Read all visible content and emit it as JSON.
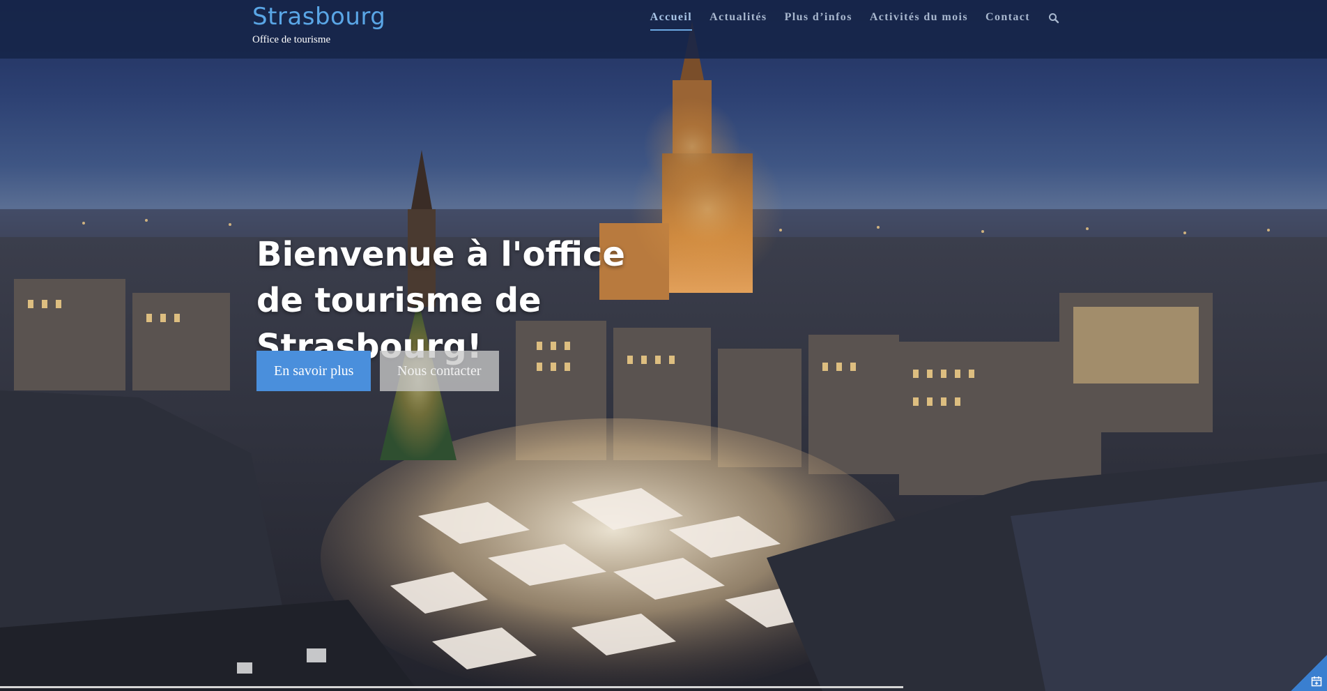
{
  "site": {
    "title": "Strasbourg",
    "subtitle": "Office de tourisme"
  },
  "nav": {
    "items": [
      {
        "label": "Accueil",
        "active": true
      },
      {
        "label": "Actualités",
        "active": false
      },
      {
        "label": "Plus d’infos",
        "active": false
      },
      {
        "label": "Activités du mois",
        "active": false
      },
      {
        "label": "Contact",
        "active": false
      }
    ],
    "search_icon": "search-icon"
  },
  "hero": {
    "title": "Bienvenue à l'office de tourisme de Strasbourg!",
    "primary_button": "En savoir plus",
    "secondary_button": "Nous contacter",
    "background": "night view of Strasbourg cathedral and Christmas market"
  },
  "colors": {
    "accent": "#4a8fdc",
    "header_bg": "#162448",
    "brand": "#5aa6e6"
  },
  "corner_widget_icon": "calendar-icon"
}
